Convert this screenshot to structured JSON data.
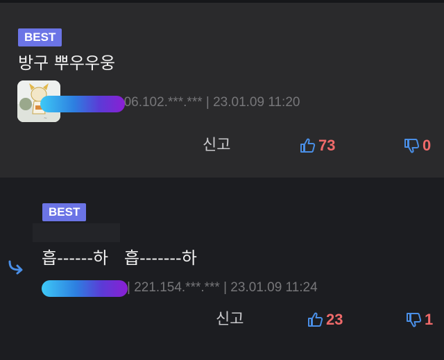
{
  "comments": [
    {
      "badge": "BEST",
      "text": "방구 뿌우우웅",
      "meta": "106.102.***.*** | 23.01.09 11:20",
      "report_label": "신고",
      "upvotes": "73",
      "downvotes": "0"
    },
    {
      "badge": "BEST",
      "text": "흡------하   흡-------하",
      "meta": "| 221.154.***.*** | 23.01.09 11:24",
      "report_label": "신고",
      "upvotes": "23",
      "downvotes": "1"
    }
  ],
  "icons": {
    "thumbs_up": "thumbs-up-icon",
    "thumbs_down": "thumbs-down-icon",
    "reply": "reply-arrow-icon"
  },
  "colors": {
    "badge": "#6b74e6",
    "vote_count": "#ef6a6a",
    "icon_blue": "#4a8fe7"
  }
}
